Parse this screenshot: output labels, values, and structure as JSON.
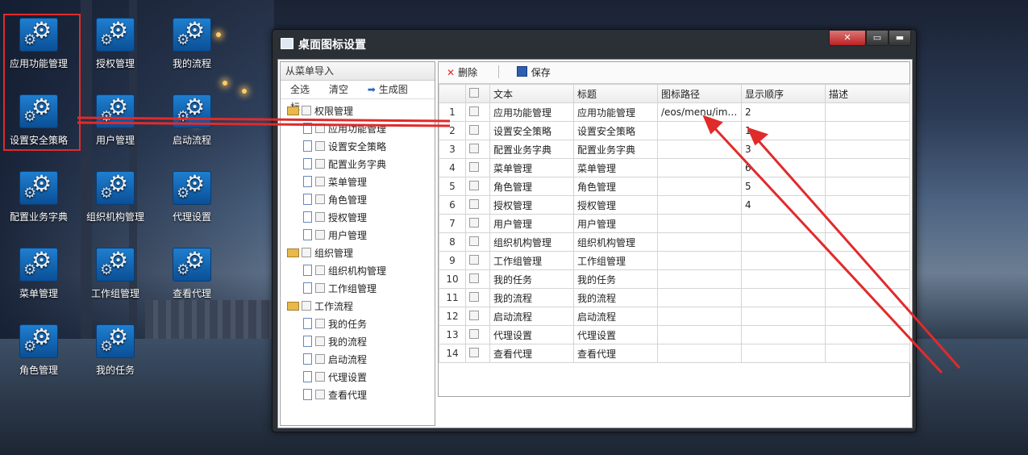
{
  "desktop": {
    "icons": [
      "应用功能管理",
      "授权管理",
      "我的流程",
      "设置安全策略",
      "用户管理",
      "启动流程",
      "配置业务字典",
      "组织机构管理",
      "代理设置",
      "菜单管理",
      "工作组管理",
      "查看代理",
      "角色管理",
      "我的任务"
    ]
  },
  "window": {
    "title": "桌面图标设置",
    "left_panel": {
      "header": "从菜单导入",
      "tools": {
        "select_all": "全选",
        "clear": "清空",
        "generate": "生成图标"
      },
      "tree": [
        {
          "label": "权限管理",
          "level": 0
        },
        {
          "label": "应用功能管理",
          "level": 1
        },
        {
          "label": "设置安全策略",
          "level": 1
        },
        {
          "label": "配置业务字典",
          "level": 1
        },
        {
          "label": "菜单管理",
          "level": 1
        },
        {
          "label": "角色管理",
          "level": 1
        },
        {
          "label": "授权管理",
          "level": 1
        },
        {
          "label": "用户管理",
          "level": 1
        },
        {
          "label": "组织管理",
          "level": 0
        },
        {
          "label": "组织机构管理",
          "level": 1
        },
        {
          "label": "工作组管理",
          "level": 1
        },
        {
          "label": "工作流程",
          "level": 0
        },
        {
          "label": "我的任务",
          "level": 1
        },
        {
          "label": "我的流程",
          "level": 1
        },
        {
          "label": "启动流程",
          "level": 1
        },
        {
          "label": "代理设置",
          "level": 1
        },
        {
          "label": "查看代理",
          "level": 1
        }
      ]
    },
    "toolbar": {
      "delete": "删除",
      "save": "保存"
    },
    "grid": {
      "columns": [
        "文本",
        "标题",
        "图标路径",
        "显示顺序",
        "描述"
      ],
      "rows": [
        {
          "n": "1",
          "text": "应用功能管理",
          "title": "应用功能管理",
          "path": "/eos/menu/ima...",
          "order": "2",
          "desc": ""
        },
        {
          "n": "2",
          "text": "设置安全策略",
          "title": "设置安全策略",
          "path": "",
          "order": "1",
          "desc": ""
        },
        {
          "n": "3",
          "text": "配置业务字典",
          "title": "配置业务字典",
          "path": "",
          "order": "3",
          "desc": ""
        },
        {
          "n": "4",
          "text": "菜单管理",
          "title": "菜单管理",
          "path": "",
          "order": "6",
          "desc": ""
        },
        {
          "n": "5",
          "text": "角色管理",
          "title": "角色管理",
          "path": "",
          "order": "5",
          "desc": ""
        },
        {
          "n": "6",
          "text": "授权管理",
          "title": "授权管理",
          "path": "",
          "order": "4",
          "desc": ""
        },
        {
          "n": "7",
          "text": "用户管理",
          "title": "用户管理",
          "path": "",
          "order": "",
          "desc": ""
        },
        {
          "n": "8",
          "text": "组织机构管理",
          "title": "组织机构管理",
          "path": "",
          "order": "",
          "desc": ""
        },
        {
          "n": "9",
          "text": "工作组管理",
          "title": "工作组管理",
          "path": "",
          "order": "",
          "desc": ""
        },
        {
          "n": "10",
          "text": "我的任务",
          "title": "我的任务",
          "path": "",
          "order": "",
          "desc": ""
        },
        {
          "n": "11",
          "text": "我的流程",
          "title": "我的流程",
          "path": "",
          "order": "",
          "desc": ""
        },
        {
          "n": "12",
          "text": "启动流程",
          "title": "启动流程",
          "path": "",
          "order": "",
          "desc": ""
        },
        {
          "n": "13",
          "text": "代理设置",
          "title": "代理设置",
          "path": "",
          "order": "",
          "desc": ""
        },
        {
          "n": "14",
          "text": "查看代理",
          "title": "查看代理",
          "path": "",
          "order": "",
          "desc": ""
        }
      ]
    }
  },
  "colors": {
    "annotation": "#e02b2b"
  }
}
